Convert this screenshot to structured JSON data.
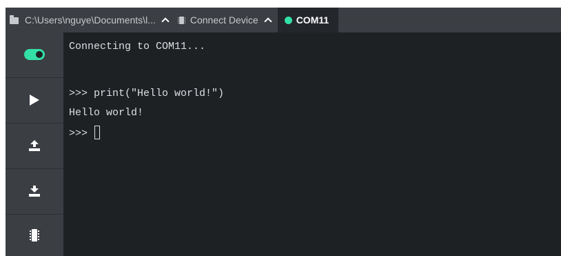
{
  "tabs": {
    "path": {
      "label": "C:\\Users\\nguye\\Documents\\l...",
      "icon": "folder-icon"
    },
    "device": {
      "label": "Connect Device",
      "icon": "chip-icon"
    },
    "port": {
      "label": "COM11",
      "status_color": "#33e0a6"
    }
  },
  "sidebar": {
    "items": [
      {
        "name": "connection-toggle",
        "icon": "toggle-icon",
        "state": "on"
      },
      {
        "name": "run",
        "icon": "play-icon"
      },
      {
        "name": "upload",
        "icon": "upload-icon"
      },
      {
        "name": "download",
        "icon": "download-icon"
      },
      {
        "name": "device",
        "icon": "chip-icon"
      }
    ]
  },
  "terminal": {
    "lines": [
      "Connecting to COM11...",
      "",
      ">>> print(\"Hello world!\")",
      "Hello world!",
      ">>> "
    ]
  },
  "colors": {
    "accent": "#33e0a6",
    "background": "#1e2124",
    "panel": "#3b3e43",
    "text": "#dcdfe3"
  }
}
